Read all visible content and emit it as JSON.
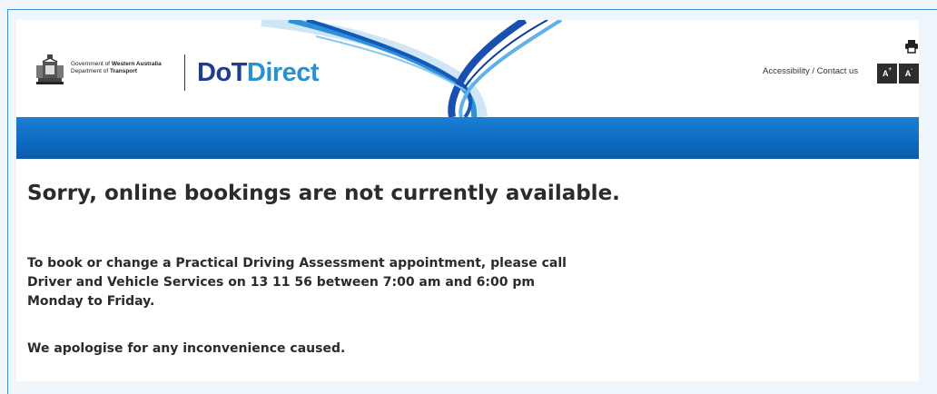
{
  "header": {
    "gov_line1_prefix": "Government of ",
    "gov_line1_bold": "Western Australia",
    "gov_line2_prefix": "Department of ",
    "gov_line2_bold": "Transport",
    "logo_part1": "DoT",
    "logo_part2": "Direct",
    "util_link": "Accessibility / Contact us",
    "font_increase_label": "A",
    "font_increase_sup": "+",
    "font_decrease_label": "A",
    "font_decrease_sup": "-",
    "print_icon": "printer-icon"
  },
  "main": {
    "heading": "Sorry, online bookings are not currently available.",
    "info_line1": "To book or change a Practical Driving Assessment appointment, please call",
    "info_line2": "Driver and Vehicle Services on 13 11 56 between 7:00 am and 6:00 pm",
    "info_line3": "Monday to Friday.",
    "apology": "We apologise for any inconvenience caused."
  },
  "colors": {
    "nav_bar": "#0e6cc2",
    "brand_dark": "#1e3d8c",
    "brand_light": "#2a90d0",
    "frame_border": "#3d8fd6"
  }
}
